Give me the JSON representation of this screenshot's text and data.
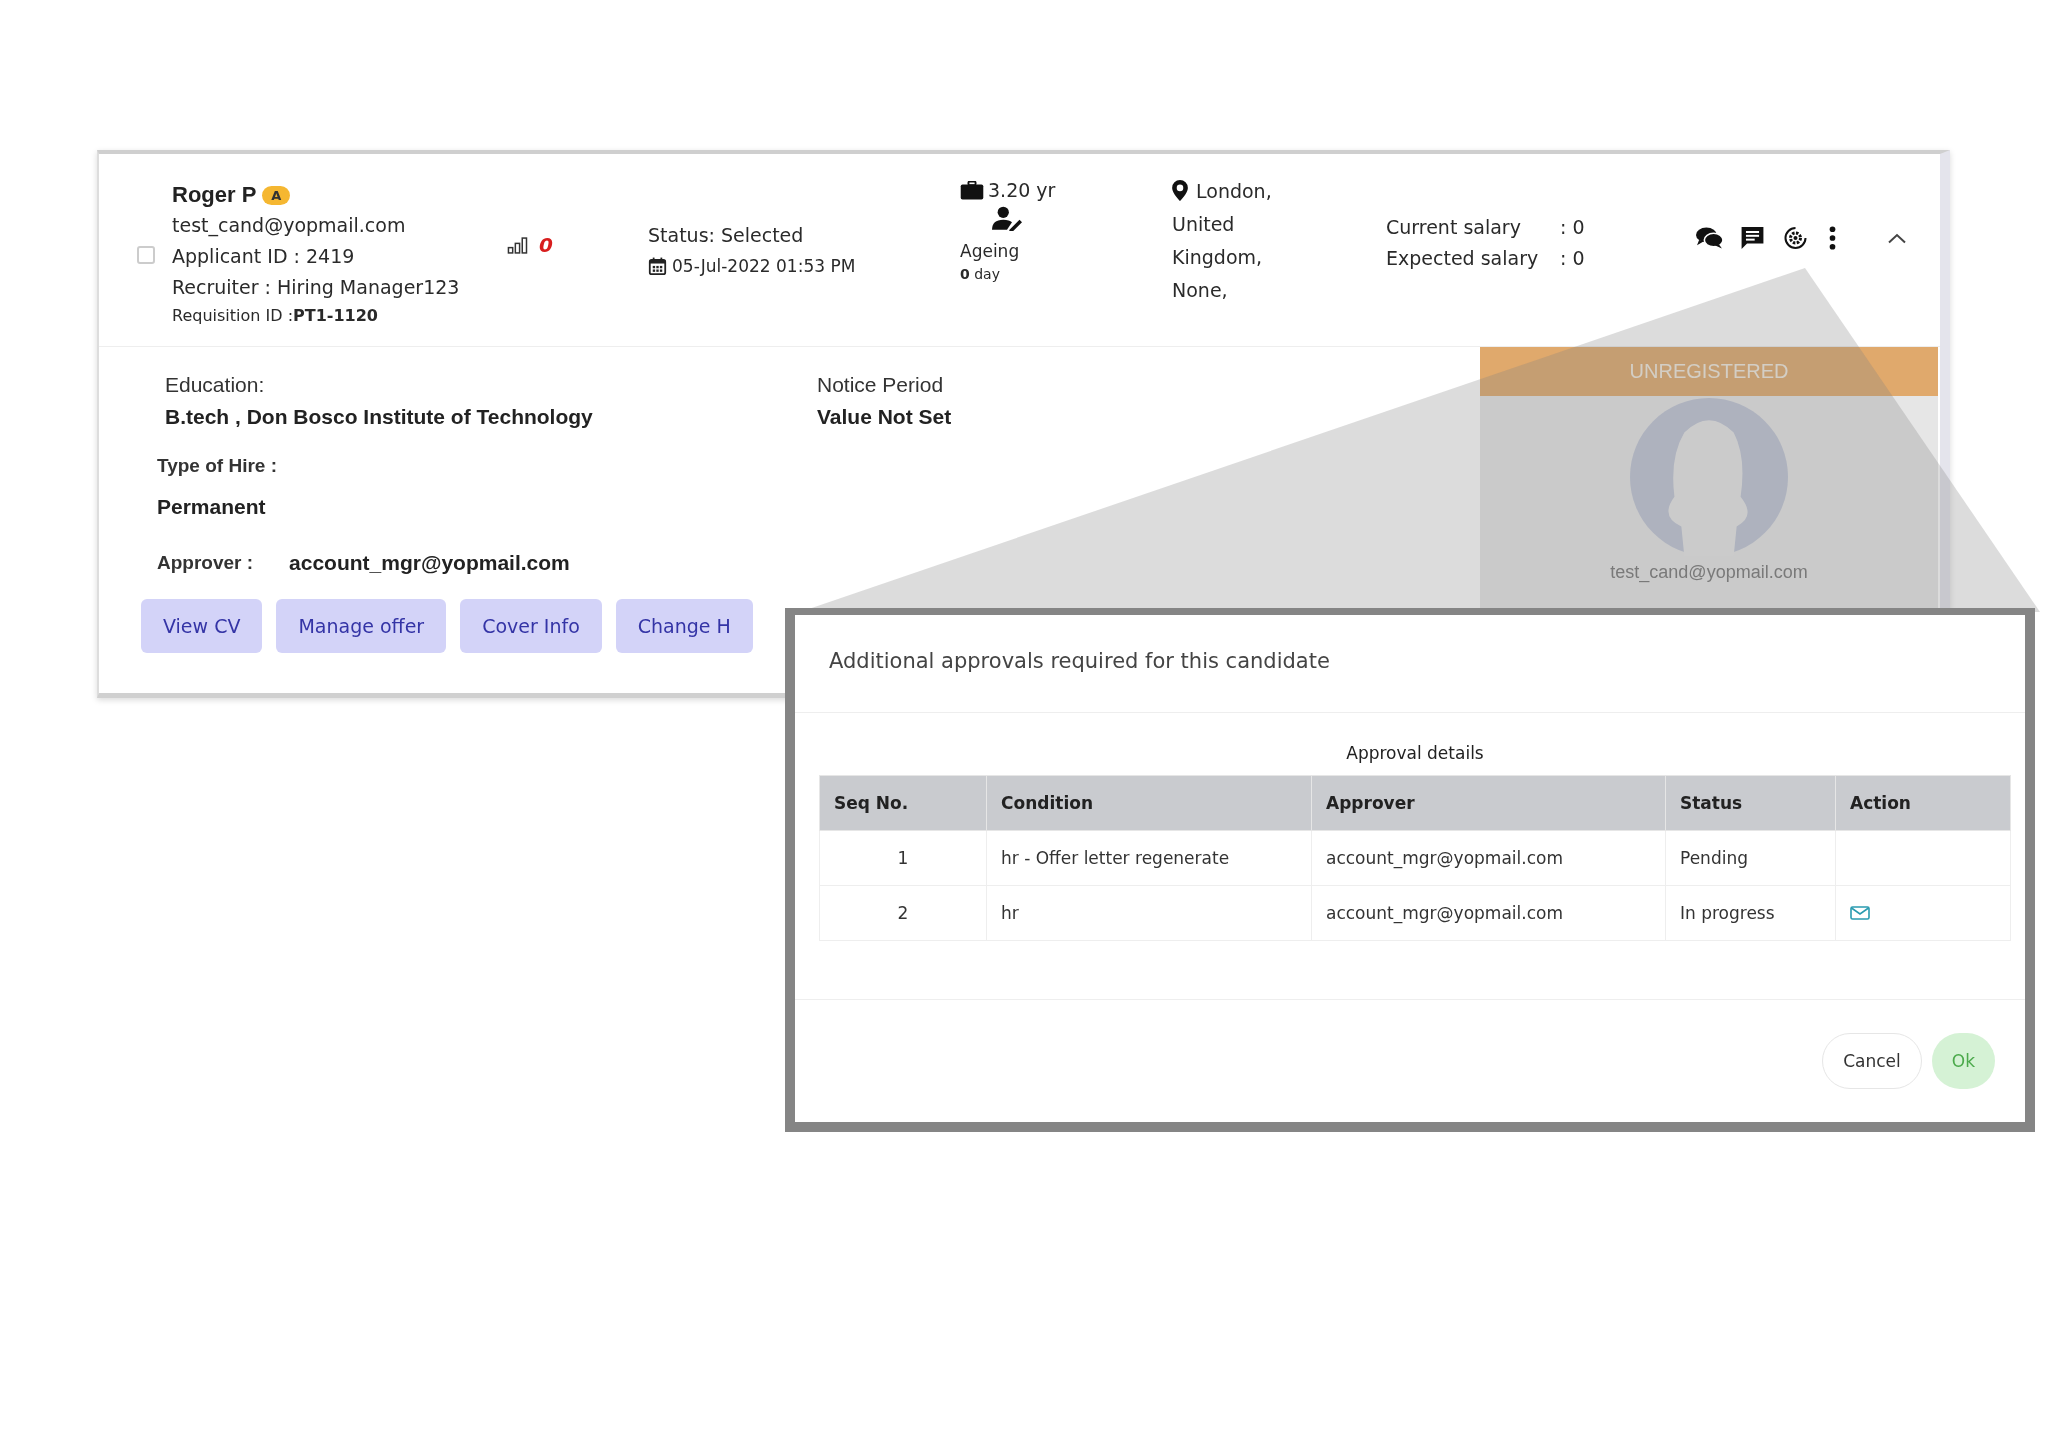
{
  "candidate": {
    "selected": false,
    "name": "Roger P",
    "badge": "A",
    "email": "test_cand@yopmail.com",
    "applicant_id": "Applicant ID : 2419",
    "recruiter": "Recruiter : Hiring Manager123",
    "requisition": "Requisition ID :**PT1-1120**",
    "score": "0",
    "status": "Status: Selected",
    "date": "05-Jul-2022 01:53 PM",
    "experience": "3.20 yr",
    "ageing_label": "Ageing",
    "ageing": "**0** day",
    "location": [
      "London,",
      "United",
      "Kingdom,",
      "None,"
    ],
    "salary": [
      {
        "label": "Current salary",
        "value": ": 0"
      },
      {
        "label": "Expected salary",
        "value": ": 0"
      }
    ]
  },
  "profile": {
    "banner": "UNREGISTERED",
    "email": "test_cand@yopmail.com"
  },
  "details": {
    "education_label": "Education:",
    "education": "B.tech , Don Bosco Institute of Technology",
    "notice_label": "Notice Period",
    "notice": "Value Not Set",
    "hire_label": "Type of Hire :",
    "hire": "Permanent",
    "approver_label": "Approver :",
    "approver": "account_mgr@yopmail.com"
  },
  "buttons": [
    "View CV",
    "Manage offer",
    "Cover Info",
    "Change H"
  ],
  "dialog": {
    "title": "Additional approvals required for this candidate",
    "caption": "Approval details",
    "columns": [
      "Seq No.",
      "Condition",
      "Approver",
      "Status",
      "Action"
    ],
    "rows": [
      {
        "seq": "1",
        "condition": "hr - Offer letter regenerate",
        "approver": "account_mgr@yopmail.com",
        "status": "Pending",
        "mail_icon": false
      },
      {
        "seq": "2",
        "condition": "hr",
        "approver": "account_mgr@yopmail.com",
        "status": "In progress",
        "mail_icon": true
      }
    ],
    "buttons": [
      {
        "label": "Cancel",
        "kind": "secondary"
      },
      {
        "label": "Ok",
        "kind": "primary"
      }
    ]
  }
}
